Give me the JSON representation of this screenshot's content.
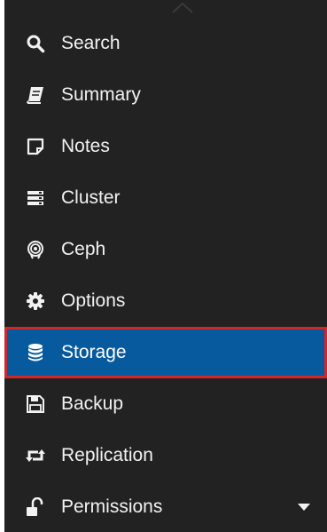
{
  "nav": {
    "items": [
      {
        "label": "Search",
        "icon": "search-icon"
      },
      {
        "label": "Summary",
        "icon": "book-icon"
      },
      {
        "label": "Notes",
        "icon": "note-icon"
      },
      {
        "label": "Cluster",
        "icon": "server-icon"
      },
      {
        "label": "Ceph",
        "icon": "ceph-icon"
      },
      {
        "label": "Options",
        "icon": "gear-icon"
      },
      {
        "label": "Storage",
        "icon": "database-icon",
        "selected": true
      },
      {
        "label": "Backup",
        "icon": "floppy-disk-icon"
      },
      {
        "label": "Replication",
        "icon": "retweet-icon"
      },
      {
        "label": "Permissions",
        "icon": "unlock-icon",
        "expandable": true
      }
    ]
  },
  "colors": {
    "background": "#222222",
    "text": "#f2f2f2",
    "selected_background": "#075a9e",
    "selected_outline": "#d0272b"
  }
}
